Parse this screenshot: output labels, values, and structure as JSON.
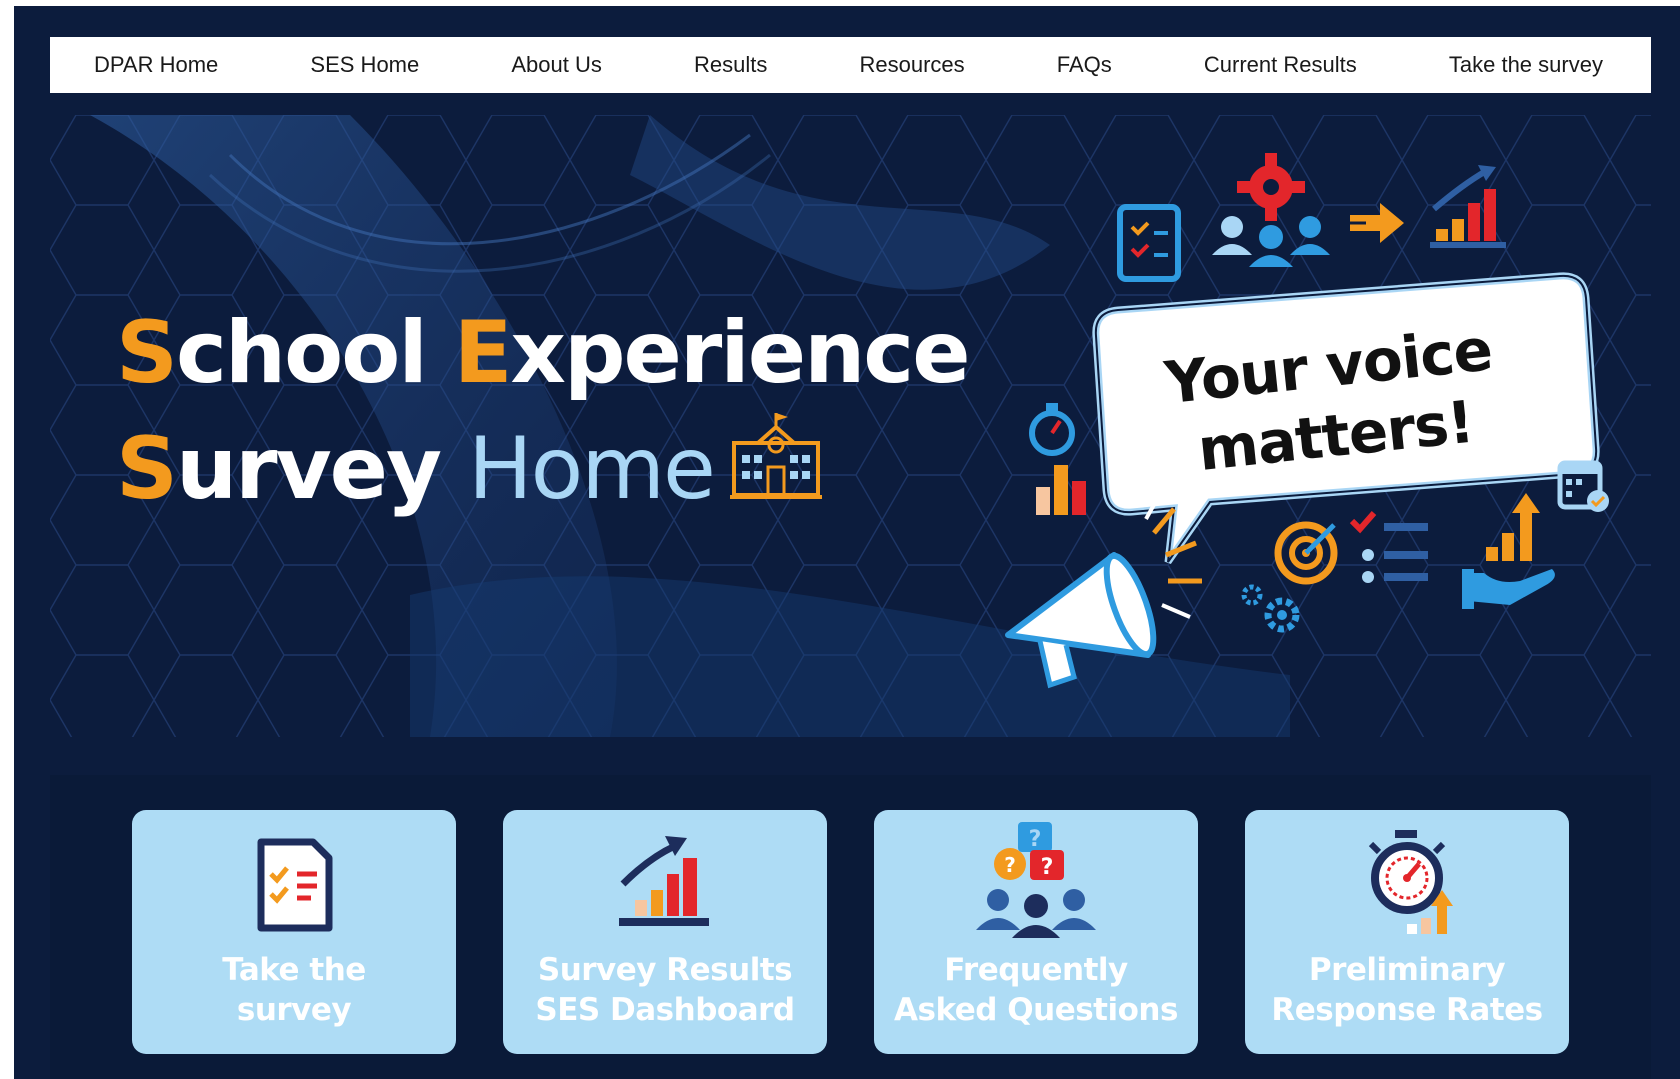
{
  "nav": {
    "items": [
      {
        "label": "DPAR Home"
      },
      {
        "label": "SES Home"
      },
      {
        "label": "About Us"
      },
      {
        "label": "Results"
      },
      {
        "label": "Resources"
      },
      {
        "label": "FAQs"
      },
      {
        "label": "Current Results"
      },
      {
        "label": "Take the survey"
      }
    ]
  },
  "hero": {
    "title_line1_a_initial": "S",
    "title_line1_a_rest": "chool ",
    "title_line1_b_initial": "E",
    "title_line1_b_rest": "xperience",
    "title_line2_initial": "S",
    "title_line2_rest": "urvey ",
    "title_line2_light": "Home",
    "bubble_line1": "Your voice",
    "bubble_line2": "matters!",
    "icons": [
      "survey-checklist-icon",
      "team-gear-icon",
      "arrow-icon",
      "growth-chart-icon",
      "stopwatch-icon",
      "bar-chart-icon",
      "megaphone-icon",
      "target-icon",
      "list-icon",
      "hand-growth-icon",
      "calendar-check-icon",
      "gears-icon",
      "school-building-icon"
    ]
  },
  "cards": [
    {
      "line1": "Take the",
      "line2": "survey",
      "icon": "survey-checklist-icon"
    },
    {
      "line1": "Survey Results",
      "line2": "SES Dashboard",
      "icon": "growth-chart-icon"
    },
    {
      "line1": "Frequently",
      "line2": "Asked Questions",
      "icon": "faq-people-icon"
    },
    {
      "line1": "Preliminary",
      "line2": "Response Rates",
      "icon": "stopwatch-growth-icon"
    }
  ],
  "colors": {
    "background": "#0c1c3d",
    "accent": "#f39a1e",
    "light_blue": "#a9d6f5",
    "card_bg": "#aedcf5",
    "red": "#e3262b"
  }
}
